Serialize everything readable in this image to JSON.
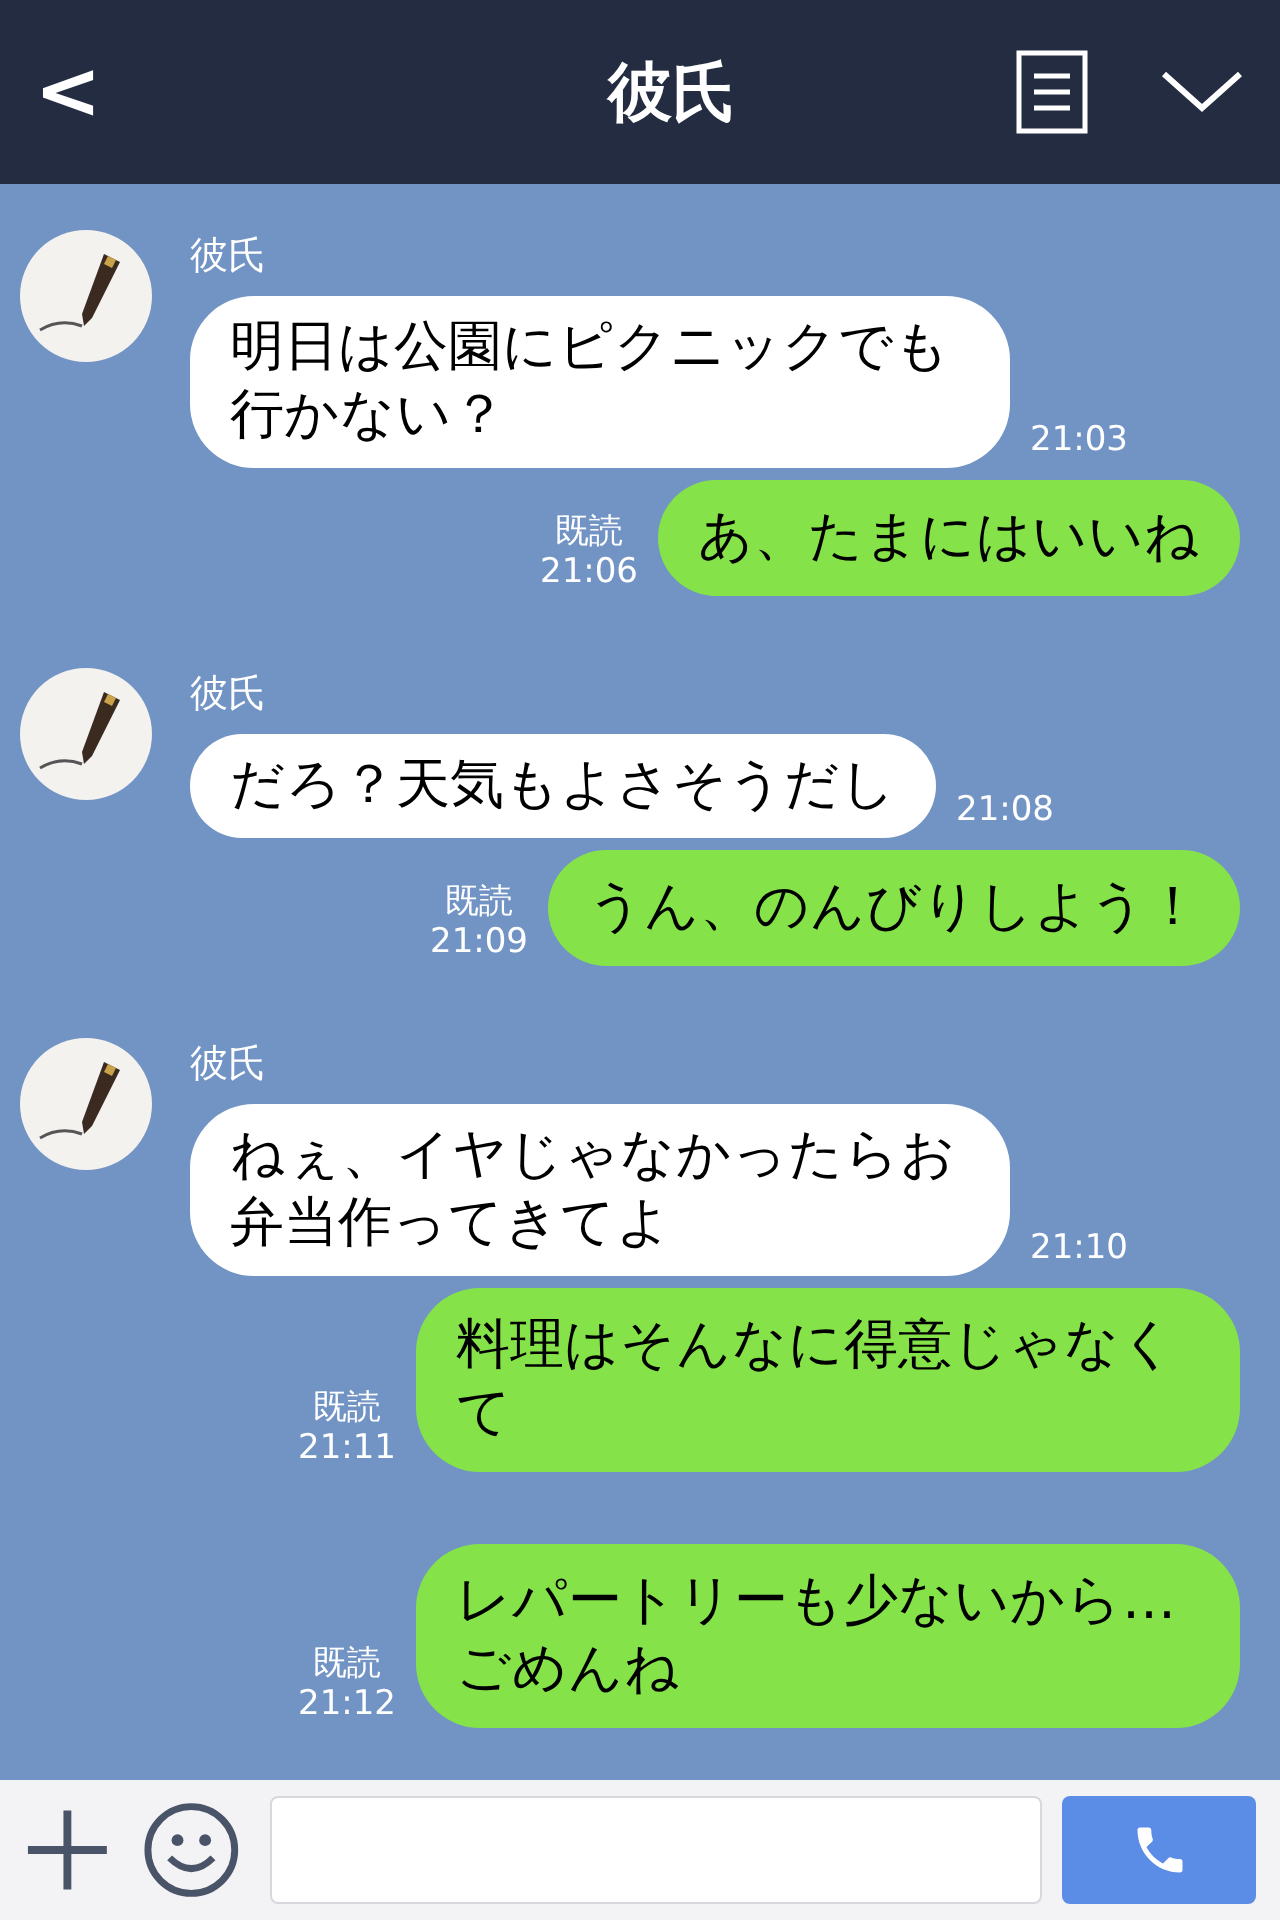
{
  "header": {
    "back": "<",
    "title": "彼氏"
  },
  "messages": [
    {
      "kind": "incoming",
      "name": "彼氏",
      "text": "明日は公園にピクニックでも行かない？",
      "time": "21:03"
    },
    {
      "kind": "outgoing",
      "read": "既読",
      "time": "21:06",
      "text": "あ、たまにはいいね"
    },
    {
      "kind": "incoming",
      "name": "彼氏",
      "text": "だろ？天気もよさそうだし",
      "time": "21:08"
    },
    {
      "kind": "outgoing",
      "read": "既読",
      "time": "21:09",
      "text": "うん、のんびりしよう！"
    },
    {
      "kind": "incoming",
      "name": "彼氏",
      "text": "ねぇ、イヤじゃなかったらお弁当作ってきてよ",
      "time": "21:10"
    },
    {
      "kind": "outgoing",
      "read": "既読",
      "time": "21:11",
      "text": "料理はそんなに得意じゃなくて"
    },
    {
      "kind": "outgoing",
      "read": "既読",
      "time": "21:12",
      "text": "レパートリーも少ないから…ごめんね"
    }
  ]
}
